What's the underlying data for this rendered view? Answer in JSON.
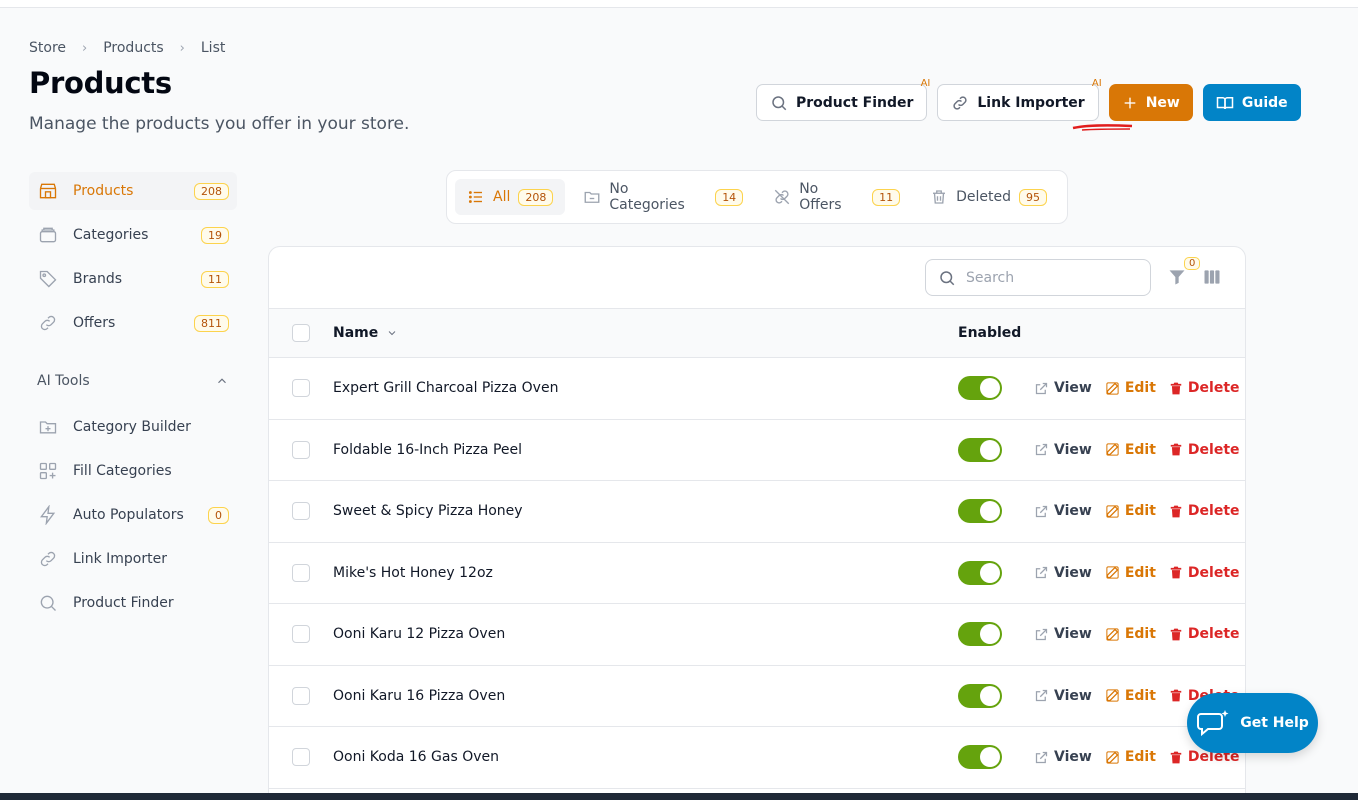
{
  "breadcrumb": {
    "items": [
      "Store",
      "Products",
      "List"
    ]
  },
  "header": {
    "title": "Products",
    "subtitle": "Manage the products you offer in your store.",
    "actions": {
      "product_finder": "Product Finder",
      "link_importer": "Link Importer",
      "ai_badge": "AI",
      "new": "New",
      "guide": "Guide"
    }
  },
  "sidebar": {
    "items": [
      {
        "label": "Products",
        "count": "208"
      },
      {
        "label": "Categories",
        "count": "19"
      },
      {
        "label": "Brands",
        "count": "11"
      },
      {
        "label": "Offers",
        "count": "811"
      }
    ],
    "ai_tools": {
      "title": "AI Tools",
      "items": [
        {
          "label": "Category Builder"
        },
        {
          "label": "Fill Categories"
        },
        {
          "label": "Auto Populators",
          "count": "0"
        },
        {
          "label": "Link Importer"
        },
        {
          "label": "Product Finder"
        }
      ]
    }
  },
  "tabs": [
    {
      "label": "All",
      "count": "208"
    },
    {
      "label": "No Categories",
      "count": "14"
    },
    {
      "label": "No Offers",
      "count": "11"
    },
    {
      "label": "Deleted",
      "count": "95"
    }
  ],
  "table": {
    "search_placeholder": "Search",
    "filter_count": "0",
    "columns": {
      "name": "Name",
      "enabled": "Enabled"
    },
    "actions": {
      "view": "View",
      "edit": "Edit",
      "delete": "Delete"
    },
    "rows": [
      {
        "name": "Expert Grill Charcoal Pizza Oven",
        "enabled": true
      },
      {
        "name": "Foldable 16-Inch Pizza Peel",
        "enabled": true
      },
      {
        "name": "Sweet & Spicy Pizza Honey",
        "enabled": true
      },
      {
        "name": "Mike's Hot Honey 12oz",
        "enabled": true
      },
      {
        "name": "Ooni Karu 12 Pizza Oven",
        "enabled": true
      },
      {
        "name": "Ooni Karu 16 Pizza Oven",
        "enabled": true
      },
      {
        "name": "Ooni Koda 16 Gas Oven",
        "enabled": true
      }
    ]
  },
  "help": {
    "label": "Get Help"
  },
  "colors": {
    "accent": "#d97706",
    "primary": "#0284c7",
    "toggle_on": "#65a30d",
    "danger": "#dc2626"
  }
}
